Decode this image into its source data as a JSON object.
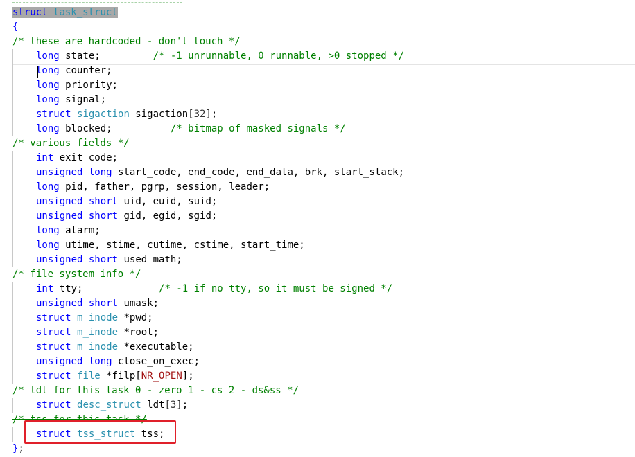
{
  "editor": {
    "lines": [
      {
        "indent": 0,
        "tokens": [
          {
            "t": "struct",
            "c": "kw",
            "hl": true
          },
          {
            "t": " ",
            "c": "pl",
            "hl": true
          },
          {
            "t": "task_struct",
            "c": "type",
            "hl": true
          }
        ]
      },
      {
        "indent": 0,
        "tokens": [
          {
            "t": "{",
            "c": "kw"
          }
        ]
      },
      {
        "indent": 0,
        "tokens": [
          {
            "t": "/* these are hardcoded - don't touch */",
            "c": "cm"
          }
        ]
      },
      {
        "indent": 1,
        "tokens": [
          {
            "t": "long",
            "c": "kw"
          },
          {
            "t": " state;         ",
            "c": "pl"
          },
          {
            "t": "/* -1 unrunnable, 0 runnable, >0 stopped */",
            "c": "cm"
          }
        ]
      },
      {
        "indent": 1,
        "cursor": true,
        "tokens": [
          {
            "t": "long",
            "c": "kw"
          },
          {
            "t": " counter;",
            "c": "pl"
          }
        ]
      },
      {
        "indent": 1,
        "tokens": [
          {
            "t": "long",
            "c": "kw"
          },
          {
            "t": " priority;",
            "c": "pl"
          }
        ]
      },
      {
        "indent": 1,
        "tokens": [
          {
            "t": "long",
            "c": "kw"
          },
          {
            "t": " signal;",
            "c": "pl"
          }
        ]
      },
      {
        "indent": 1,
        "tokens": [
          {
            "t": "struct",
            "c": "kw"
          },
          {
            "t": " ",
            "c": "pl"
          },
          {
            "t": "sigaction",
            "c": "type"
          },
          {
            "t": " sigaction",
            "c": "pl"
          },
          {
            "t": "[32]",
            "c": "num"
          },
          {
            "t": ";",
            "c": "pl"
          }
        ]
      },
      {
        "indent": 1,
        "tokens": [
          {
            "t": "long",
            "c": "kw"
          },
          {
            "t": " blocked;          ",
            "c": "pl"
          },
          {
            "t": "/* bitmap of masked signals */",
            "c": "cm"
          }
        ]
      },
      {
        "indent": 0,
        "tokens": [
          {
            "t": "/* various fields */",
            "c": "cm"
          }
        ]
      },
      {
        "indent": 1,
        "tokens": [
          {
            "t": "int",
            "c": "kw"
          },
          {
            "t": " exit_code;",
            "c": "pl"
          }
        ]
      },
      {
        "indent": 1,
        "tokens": [
          {
            "t": "unsigned",
            "c": "kw"
          },
          {
            "t": " ",
            "c": "pl"
          },
          {
            "t": "long",
            "c": "kw"
          },
          {
            "t": " start_code, end_code, end_data, brk, start_stack;",
            "c": "pl"
          }
        ]
      },
      {
        "indent": 1,
        "tokens": [
          {
            "t": "long",
            "c": "kw"
          },
          {
            "t": " pid, father, pgrp, session, leader;",
            "c": "pl"
          }
        ]
      },
      {
        "indent": 1,
        "tokens": [
          {
            "t": "unsigned",
            "c": "kw"
          },
          {
            "t": " ",
            "c": "pl"
          },
          {
            "t": "short",
            "c": "kw"
          },
          {
            "t": " uid, euid, suid;",
            "c": "pl"
          }
        ]
      },
      {
        "indent": 1,
        "tokens": [
          {
            "t": "unsigned",
            "c": "kw"
          },
          {
            "t": " ",
            "c": "pl"
          },
          {
            "t": "short",
            "c": "kw"
          },
          {
            "t": " gid, egid, sgid;",
            "c": "pl"
          }
        ]
      },
      {
        "indent": 1,
        "tokens": [
          {
            "t": "long",
            "c": "kw"
          },
          {
            "t": " alarm;",
            "c": "pl"
          }
        ]
      },
      {
        "indent": 1,
        "tokens": [
          {
            "t": "long",
            "c": "kw"
          },
          {
            "t": " utime, stime, cutime, cstime, start_time;",
            "c": "pl"
          }
        ]
      },
      {
        "indent": 1,
        "tokens": [
          {
            "t": "unsigned",
            "c": "kw"
          },
          {
            "t": " ",
            "c": "pl"
          },
          {
            "t": "short",
            "c": "kw"
          },
          {
            "t": " used_math;",
            "c": "pl"
          }
        ]
      },
      {
        "indent": 0,
        "tokens": [
          {
            "t": "/* file system info */",
            "c": "cm"
          }
        ]
      },
      {
        "indent": 1,
        "tokens": [
          {
            "t": "int",
            "c": "kw"
          },
          {
            "t": " tty;             ",
            "c": "pl"
          },
          {
            "t": "/* -1 if no tty, so it must be signed */",
            "c": "cm"
          }
        ]
      },
      {
        "indent": 1,
        "tokens": [
          {
            "t": "unsigned",
            "c": "kw"
          },
          {
            "t": " ",
            "c": "pl"
          },
          {
            "t": "short",
            "c": "kw"
          },
          {
            "t": " umask;",
            "c": "pl"
          }
        ]
      },
      {
        "indent": 1,
        "tokens": [
          {
            "t": "struct",
            "c": "kw"
          },
          {
            "t": " ",
            "c": "pl"
          },
          {
            "t": "m_inode",
            "c": "type"
          },
          {
            "t": " *pwd;",
            "c": "pl"
          }
        ]
      },
      {
        "indent": 1,
        "tokens": [
          {
            "t": "struct",
            "c": "kw"
          },
          {
            "t": " ",
            "c": "pl"
          },
          {
            "t": "m_inode",
            "c": "type"
          },
          {
            "t": " *root;",
            "c": "pl"
          }
        ]
      },
      {
        "indent": 1,
        "tokens": [
          {
            "t": "struct",
            "c": "kw"
          },
          {
            "t": " ",
            "c": "pl"
          },
          {
            "t": "m_inode",
            "c": "type"
          },
          {
            "t": " *executable;",
            "c": "pl"
          }
        ]
      },
      {
        "indent": 1,
        "tokens": [
          {
            "t": "unsigned",
            "c": "kw"
          },
          {
            "t": " ",
            "c": "pl"
          },
          {
            "t": "long",
            "c": "kw"
          },
          {
            "t": " close_on_exec;",
            "c": "pl"
          }
        ]
      },
      {
        "indent": 1,
        "tokens": [
          {
            "t": "struct",
            "c": "kw"
          },
          {
            "t": " ",
            "c": "pl"
          },
          {
            "t": "file",
            "c": "type"
          },
          {
            "t": " *filp[",
            "c": "pl"
          },
          {
            "t": "NR_OPEN",
            "c": "mac"
          },
          {
            "t": "];",
            "c": "pl"
          }
        ]
      },
      {
        "indent": 0,
        "tokens": [
          {
            "t": "/* ldt for this task 0 - zero 1 - cs 2 - ds&ss */",
            "c": "cm"
          }
        ]
      },
      {
        "indent": 1,
        "tokens": [
          {
            "t": "struct",
            "c": "kw"
          },
          {
            "t": " ",
            "c": "pl"
          },
          {
            "t": "desc_struct",
            "c": "type"
          },
          {
            "t": " ldt",
            "c": "pl"
          },
          {
            "t": "[3]",
            "c": "num"
          },
          {
            "t": ";",
            "c": "pl"
          }
        ]
      },
      {
        "indent": 0,
        "tokens": [
          {
            "t": "/* tss for this task */",
            "c": "cm",
            "strike": true
          }
        ]
      },
      {
        "indent": 1,
        "highlighted": true,
        "tokens": [
          {
            "t": "struct",
            "c": "kw"
          },
          {
            "t": " ",
            "c": "pl"
          },
          {
            "t": "tss_struct",
            "c": "type"
          },
          {
            "t": " tss;",
            "c": "pl"
          }
        ]
      },
      {
        "indent": 0,
        "tokens": [
          {
            "t": "}",
            "c": "kw"
          },
          {
            "t": ";",
            "c": "pl"
          }
        ]
      }
    ]
  }
}
